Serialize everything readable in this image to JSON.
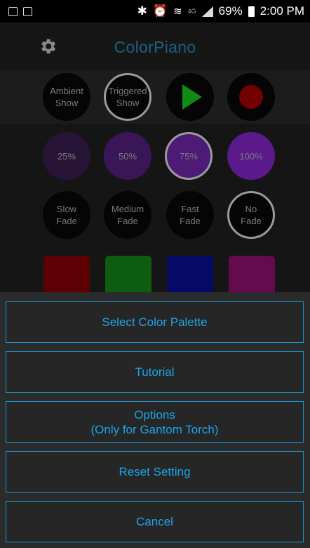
{
  "status_bar": {
    "battery": "69%",
    "time": "2:00 PM",
    "network": "4G",
    "icons": [
      "gallery-icon",
      "image-icon",
      "bluetooth-icon",
      "alarm-icon",
      "wifi-icon",
      "signal-icon",
      "battery-icon"
    ]
  },
  "header": {
    "title": "ColorPiano",
    "settings_icon": "gear-icon"
  },
  "shows": [
    {
      "label_line1": "Ambient",
      "label_line2": "Show",
      "selected": false
    },
    {
      "label_line1": "Triggered",
      "label_line2": "Show",
      "selected": true
    },
    {
      "icon": "play-icon",
      "color": "#138a13"
    },
    {
      "icon": "record-icon",
      "color": "#730000"
    }
  ],
  "brightness": [
    {
      "label": "25%",
      "color": "#281436",
      "selected": false
    },
    {
      "label": "50%",
      "color": "#3a1658",
      "selected": false
    },
    {
      "label": "75%",
      "color": "#4d1a76",
      "selected": true
    },
    {
      "label": "100%",
      "color": "#5a1a8c",
      "selected": false
    }
  ],
  "fades": [
    {
      "line1": "Slow",
      "line2": "Fade",
      "selected": false
    },
    {
      "line1": "Medium",
      "line2": "Fade",
      "selected": false
    },
    {
      "line1": "Fast",
      "line2": "Fade",
      "selected": false
    },
    {
      "line1": "No",
      "line2": "Fade",
      "selected": true
    }
  ],
  "swatch_colors": [
    "#5c0004",
    "#0d5c10",
    "#050a66",
    "#640a4d"
  ],
  "menu": {
    "select_palette": "Select Color Palette",
    "tutorial": "Tutorial",
    "options_line1": "Options",
    "options_line2": "(Only for Gantom Torch)",
    "reset": "Reset Setting",
    "cancel": "Cancel"
  }
}
